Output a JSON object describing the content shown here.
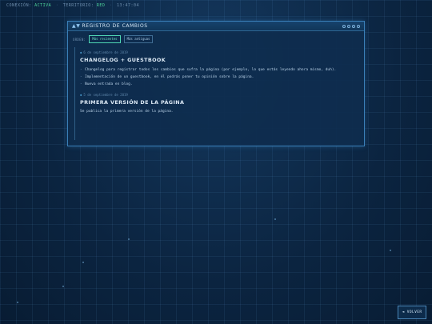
{
  "status": {
    "connection_label": "CONEXIÓN:",
    "connection_value": "ACTIVA",
    "territory_label": "TERRITORIO:",
    "territory_value": "RED",
    "time": "13:47:04"
  },
  "window": {
    "title_arrows": "▲▼",
    "title": "REGISTRO DE CAMBIOS"
  },
  "toolbar": {
    "order_label": "ORDEN:",
    "newest_label": "Más recientes",
    "oldest_label": "Más antiguas"
  },
  "entries": [
    {
      "date": "6 de septiembre de 2019",
      "title": "CHANGELOG + GUESTBOOK",
      "items": [
        "Changelog para registrar todos los cambios que sufra la página (por ejemplo, lo que estás leyendo ahora mismo, duh).",
        "Implementación de un guestbook, en él podrás poner tu opinión sobre la página.",
        "Nueva entrada en blog."
      ]
    },
    {
      "date": "5 de septiembre de 2019",
      "title": "PRIMERA VERSIÓN DE LA PÁGINA",
      "body": "Se publica la primera versión de la página."
    }
  ],
  "back_button": "◄ VOLVER",
  "colors": {
    "background": "#0b2440",
    "panel": "#0e2d4e",
    "accent": "#4fd6b4",
    "border": "#3a7fb8",
    "status_green": "#4fd69c"
  }
}
